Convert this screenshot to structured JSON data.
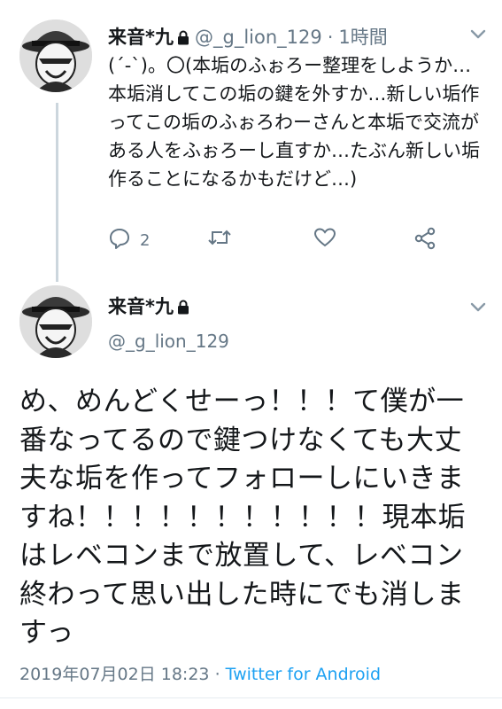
{
  "tweet1": {
    "display_name": "来音*九",
    "handle": "@_g_lion_129",
    "separator": "·",
    "time": "1時間",
    "text": "(´-`)。〇(本垢のふぉろー整理をしようか…本垢消してこの垢の鍵を外すか…新しい垢作ってこの垢のふぉろわーさんと本垢で交流がある人をふぉろーし直すか…たぶん新しい垢作ることになるかもだけど…)",
    "reply_count": "2",
    "icons": [
      "lock-icon",
      "chevron-down-icon",
      "reply-icon",
      "retweet-icon",
      "like-icon",
      "share-icon"
    ]
  },
  "tweet2": {
    "display_name": "来音*九",
    "handle": "@_g_lion_129",
    "text": "め、めんどくせーっ！！！て僕が一番なってるので鍵つけなくても大丈夫な垢を作ってフォローしにいきますね！！！！！！！！！！！現本垢はレベコンまで放置して、レベコン終わって思い出した時にでも消しますっ",
    "timestamp": "2019年07月02日 18:23",
    "separator": "·",
    "source": "Twitter for Android",
    "icons": [
      "lock-icon",
      "chevron-down-icon"
    ]
  },
  "colors": {
    "text": "#14171a",
    "muted": "#657786",
    "link": "#1da1f2",
    "thread_line": "#ccd6dd"
  }
}
